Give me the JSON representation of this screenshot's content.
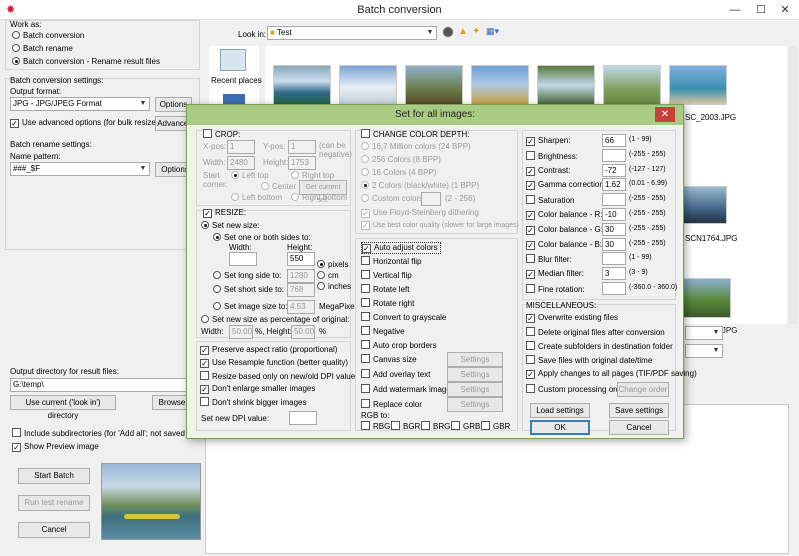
{
  "window": {
    "title": "Batch conversion"
  },
  "left": {
    "work_as": "Work as:",
    "mode_options": [
      "Batch conversion",
      "Batch rename",
      "Batch conversion - Rename result files"
    ],
    "settings_title": "Batch conversion settings:",
    "output_format_label": "Output format:",
    "output_format_value": "JPG - JPG/JPEG Format",
    "options_btn": "Options",
    "use_advanced": "Use advanced options (for bulk resize...)",
    "advanced_btn": "Advanced",
    "rename_settings": "Batch rename settings:",
    "name_pattern_label": "Name pattern:",
    "name_pattern_value": "###_$F",
    "rename_options_btn": "Options",
    "output_dir_label": "Output directory for result files:",
    "output_dir_value": "G:\\temp\\",
    "use_current_btn": "Use current ('look in') directory",
    "browse_btn": "Browse",
    "include_sub": "Include subdirectories (for 'Add all'; not saved on exit)",
    "show_preview": "Show Preview image",
    "start_btn": "Start Batch",
    "run_test_btn": "Run test rename",
    "cancel_btn": "Cancel"
  },
  "browser": {
    "look_in_label": "Look in:",
    "look_in_value": "Test",
    "recent_places": "Recent places",
    "file_labels": [
      "SC_2003.JPG",
      "SCN1764.JPG",
      "SCN2016.JPG"
    ]
  },
  "dialog": {
    "title": "Set for all images:",
    "crop": {
      "title": "CROP:",
      "xpos_label": "X-pos:",
      "xpos": "1",
      "ypos_label": "Y-pos:",
      "ypos": "1",
      "can_be_negative": "(can be negative)",
      "width_label": "Width:",
      "width": "2480",
      "height_label": "Height:",
      "height": "1753",
      "start_corner": "Start corner:",
      "corners": [
        "Left top",
        "Right top",
        "Center",
        "Left bottom",
        "Right bottom"
      ],
      "get_current": "Get current sel."
    },
    "resize": {
      "title": "RESIZE:",
      "set_new_size": "Set new size:",
      "one_or_both": "Set one or both sides to:",
      "width_label": "Width:",
      "height_label": "Height:",
      "width_value": "",
      "height_value": "550",
      "units": [
        "pixels",
        "cm",
        "inches"
      ],
      "long_side": "Set long side to:",
      "long_value": "1280",
      "short_side": "Set short side to:",
      "short_value": "768",
      "image_size": "Set image size to:",
      "image_size_value": "4.53",
      "megapixel": "MegaPixel",
      "percentage": "Set new size as percentage of original:",
      "pct_width_label": "Width:",
      "pct_width": "50.00",
      "pct_height_label": "%, Height:",
      "pct_height": "50.00",
      "pct_sign": "%"
    },
    "resize_opts": [
      "Preserve aspect ratio (proportional)",
      "Use Resample function (better quality)",
      "Resize based only on new/old DPI value",
      "Don't enlarge smaller images",
      "Don't shrink bigger images"
    ],
    "dpi_label": "Set new DPI value:",
    "color_depth": {
      "title": "CHANGE COLOR DEPTH:",
      "options": [
        "16,7 Million colors (24 BPP)",
        "256 Colors (8 BPP)",
        "16 Colors (4 BPP)",
        "2 Colors (black/white) (1 BPP)",
        "Custom colors:"
      ],
      "custom_range": "(2 - 256)",
      "floyd": "Use Floyd-Steinberg dithering",
      "best": "Use best color quality (slower for large images)"
    },
    "middle_checks": [
      "Auto adjust colors",
      "Horizontal flip",
      "Vertical flip",
      "Rotate left",
      "Rotate right",
      "Convert to grayscale",
      "Negative",
      "Auto crop borders",
      "Canvas size",
      "Add overlay text",
      "Add watermark image",
      "Replace color"
    ],
    "settings_btn": "Settings",
    "rgb_label": "RGB to:",
    "rgb_opts": [
      "RBG",
      "BGR",
      "BRG",
      "GRB",
      "GBR"
    ],
    "adjust": [
      {
        "label": "Sharpen:",
        "value": "66",
        "range": "(1 - 99)"
      },
      {
        "label": "Brightness:",
        "value": "",
        "range": "(-255 - 255)"
      },
      {
        "label": "Contrast:",
        "value": "-72",
        "range": "(-127 - 127)"
      },
      {
        "label": "Gamma correction:",
        "value": "1.62",
        "range": "(0.01 - 6.99)"
      },
      {
        "label": "Saturation",
        "value": "",
        "range": "(-255 - 255)"
      },
      {
        "label": "Color balance - R:",
        "value": "-10",
        "range": "(-255 - 255)"
      },
      {
        "label": "Color balance - G:",
        "value": "30",
        "range": "(-255 - 255)"
      },
      {
        "label": "Color balance - B:",
        "value": "30",
        "range": "(-255 - 255)"
      },
      {
        "label": "Blur filter:",
        "value": "",
        "range": "(1 - 99)"
      },
      {
        "label": "Median filter:",
        "value": "3",
        "range": "(3 - 9)"
      },
      {
        "label": "Fine rotation:",
        "value": "",
        "range": "(-360.0 - 360.0)"
      }
    ],
    "misc_title": "MISCELLANEOUS:",
    "misc": [
      "Overwrite existing files",
      "Delete original files after conversion",
      "Create subfolders in destination folder",
      "Save files with original date/time",
      "Apply changes to all pages (TIF/PDF saving)",
      "Custom processing order"
    ],
    "change_order": "Change order",
    "load_btn": "Load settings",
    "save_btn": "Save settings",
    "ok_btn": "OK",
    "cancel_btn": "Cancel"
  }
}
